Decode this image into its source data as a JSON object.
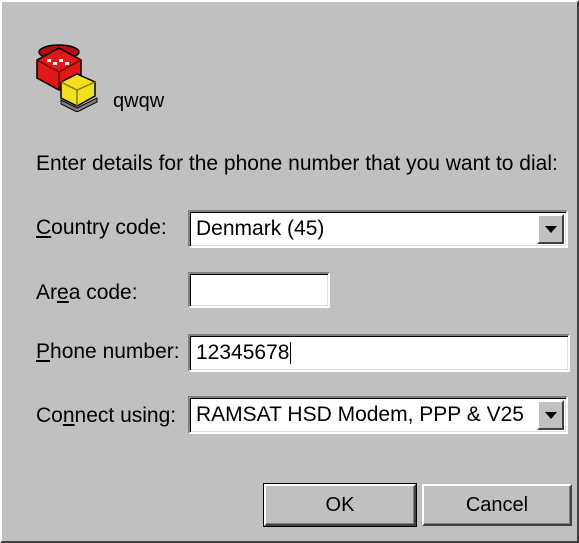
{
  "connection": {
    "name": "qwqw",
    "icon": "telephone-icon"
  },
  "form": {
    "intro": "Enter details for the phone number that you want to dial:",
    "country_code": {
      "label": "Country code:",
      "value": "Denmark (45)"
    },
    "area_code": {
      "label": "Area code:",
      "value": ""
    },
    "phone_number": {
      "label": "Phone number:",
      "value": "12345678"
    },
    "connect_using": {
      "label": "Connect using:",
      "value": "RAMSAT HSD Modem, PPP & V25"
    }
  },
  "buttons": {
    "ok": "OK",
    "cancel": "Cancel"
  },
  "colors": {
    "face": "#c0c0c0",
    "phone_red": "#e01818",
    "phone_yellow": "#f0e020"
  }
}
